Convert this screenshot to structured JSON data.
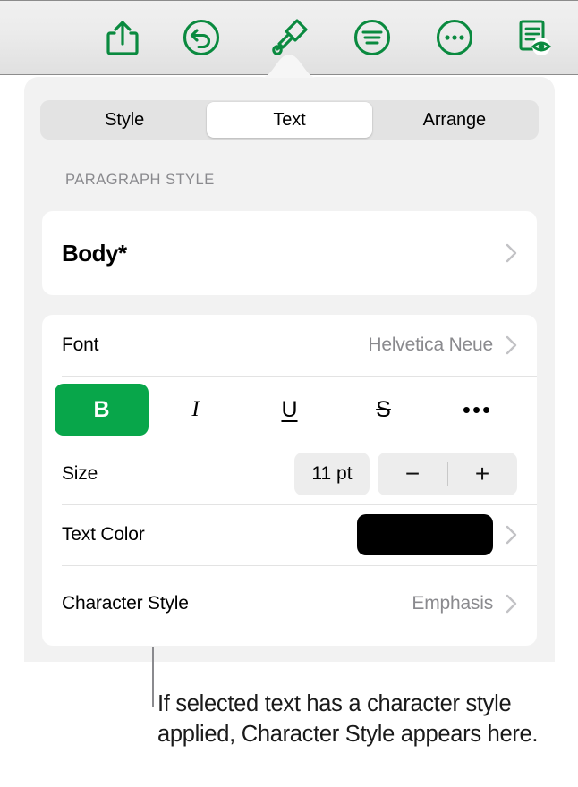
{
  "toolbar": {
    "buttons": [
      {
        "name": "share-icon",
        "label": "Share"
      },
      {
        "name": "undo-icon",
        "label": "Undo"
      },
      {
        "name": "format-brush-icon",
        "label": "Format"
      },
      {
        "name": "text-align-icon",
        "label": "Insert"
      },
      {
        "name": "more-options-icon",
        "label": "More"
      },
      {
        "name": "document-preview-icon",
        "label": "Document Options"
      }
    ]
  },
  "popover": {
    "segmented": {
      "options": [
        "Style",
        "Text",
        "Arrange"
      ],
      "selected": "Text"
    },
    "section_label": "PARAGRAPH STYLE",
    "paragraph_style": {
      "value": "Body*"
    },
    "font": {
      "label": "Font",
      "value": "Helvetica Neue"
    },
    "format": {
      "bold": "B",
      "italic": "I",
      "underline": "U",
      "strikethrough": "S",
      "more": "•••",
      "active": "bold"
    },
    "size": {
      "label": "Size",
      "value": "11 pt",
      "decrease": "−",
      "increase": "+"
    },
    "text_color": {
      "label": "Text Color",
      "swatch": "#000000"
    },
    "character_style": {
      "label": "Character Style",
      "value": "Emphasis"
    }
  },
  "callout": {
    "text": "If selected text has a character style applied, Character Style appears here."
  },
  "colors": {
    "accent_green": "#08a64a",
    "muted_text": "#8a8a8e"
  }
}
